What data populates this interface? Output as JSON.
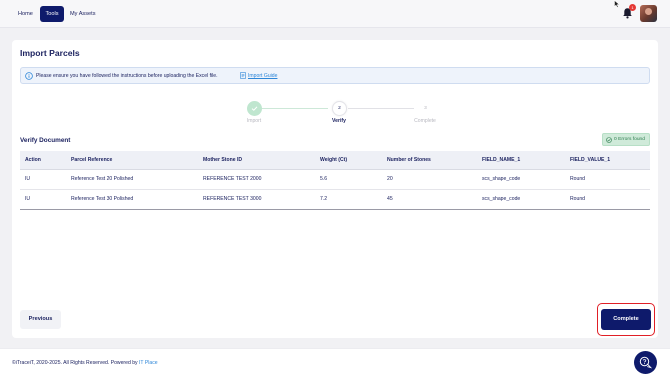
{
  "nav": {
    "home": "Home",
    "tools": "Tools",
    "my_assets": "My Assets",
    "notification_count": "1"
  },
  "page": {
    "title": "Import Parcels",
    "info_text": "Please ensure you have followed the instructions before uploading the Excel file.",
    "import_guide_link": "Import Guide"
  },
  "stepper": {
    "steps": [
      {
        "number": "1",
        "label": "Import",
        "state": "done"
      },
      {
        "number": "2",
        "label": "Verify",
        "state": "active"
      },
      {
        "number": "3",
        "label": "Complete",
        "state": "todo"
      }
    ]
  },
  "verify": {
    "title": "Verify Document",
    "errors_badge": "0 Errors found"
  },
  "table": {
    "headers": [
      "Action",
      "Parcel Reference",
      "Mother Stone ID",
      "Weight (Ct)",
      "Number of Stones",
      "FIELD_NAME_1",
      "FIELD_VALUE_1"
    ],
    "rows": [
      [
        "IU",
        "Reference Test 20 Polished",
        "REFERENCE TEST 2000",
        "5.6",
        "20",
        "scs_shape_code",
        "Round"
      ],
      [
        "IU",
        "Reference Test 30 Polished",
        "REFERENCE TEST 3000",
        "7.2",
        "45",
        "scs_shape_code",
        "Round"
      ]
    ]
  },
  "buttons": {
    "previous": "Previous",
    "complete": "Complete"
  },
  "footer": {
    "copyright": "©iTraceiT, 2020-2025. All Rights Reserved. Powered by",
    "powered_by": "IT Place"
  },
  "colors": {
    "brand_navy": "#0e1a6b",
    "success_green": "#cfead9",
    "highlight_red": "#e01f26",
    "link_blue": "#2d86d8"
  }
}
